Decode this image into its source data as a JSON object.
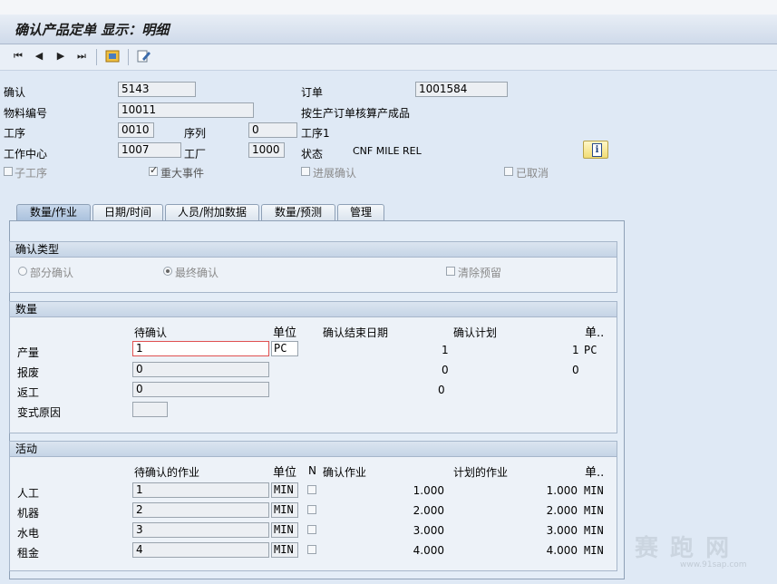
{
  "window": {
    "title": "确认产品定单 显示：明细"
  },
  "toolbar": {
    "first": "⏮",
    "prev": "◀",
    "next": "▶",
    "last": "⏭"
  },
  "header": {
    "confirm_label": "确认",
    "confirm_value": "5143",
    "order_label": "订单",
    "order_value": "1001584",
    "material_label": "物料编号",
    "material_value": "10011",
    "material_desc": "按生产订单核算产成品",
    "operation_label": "工序",
    "operation_value": "0010",
    "sequence_label": "序列",
    "sequence_value": "0",
    "operation_text": "工序1",
    "workcenter_label": "工作中心",
    "workcenter_value": "1007",
    "plant_label": "工厂",
    "plant_value": "1000",
    "status_label": "状态",
    "status_value": "CNF  MILE REL",
    "info_button": "i",
    "sub_op": "子工序",
    "major_event": "重大事件",
    "progress_confirm": "进展确认",
    "cancelled": "已取消"
  },
  "tabs": [
    "数量/作业",
    "日期/时间",
    "人员/附加数据",
    "数量/预测",
    "管理"
  ],
  "confirm_type": {
    "title": "确认类型",
    "partial": "部分确认",
    "final": "最终确认",
    "clear_reservation": "清除预留"
  },
  "quantity": {
    "title": "数量",
    "col_pending": "待确认",
    "col_unit": "单位",
    "col_end_date": "确认结束日期",
    "col_plan": "确认计划",
    "col_unit2": "单..",
    "rows": [
      {
        "label": "产量",
        "value": "1",
        "unit": "PC",
        "confirmed": "1",
        "plan": "1",
        "plan_unit": "PC"
      },
      {
        "label": "报废",
        "value": "0",
        "confirmed": "0",
        "plan": "0"
      },
      {
        "label": "返工",
        "value": "0",
        "confirmed": "0"
      },
      {
        "label": "变式原因",
        "value": ""
      }
    ]
  },
  "activity": {
    "title": "活动",
    "col_pending": "待确认的作业",
    "col_unit": "单位",
    "col_n": "N",
    "col_confirm": "确认作业",
    "col_planned": "计划的作业",
    "col_unit2": "单..",
    "rows": [
      {
        "label": "人工",
        "value": "1",
        "unit": "MIN",
        "confirmed": "1.000",
        "planned": "1.000",
        "planned_unit": "MIN"
      },
      {
        "label": "机器",
        "value": "2",
        "unit": "MIN",
        "confirmed": "2.000",
        "planned": "2.000",
        "planned_unit": "MIN"
      },
      {
        "label": "水电",
        "value": "3",
        "unit": "MIN",
        "confirmed": "3.000",
        "planned": "3.000",
        "planned_unit": "MIN"
      },
      {
        "label": "租金",
        "value": "4",
        "unit": "MIN",
        "confirmed": "4.000",
        "planned": "4.000",
        "planned_unit": "MIN"
      }
    ]
  },
  "watermark": {
    "text": "赛 跑 网",
    "url": "www.91sap.com"
  }
}
